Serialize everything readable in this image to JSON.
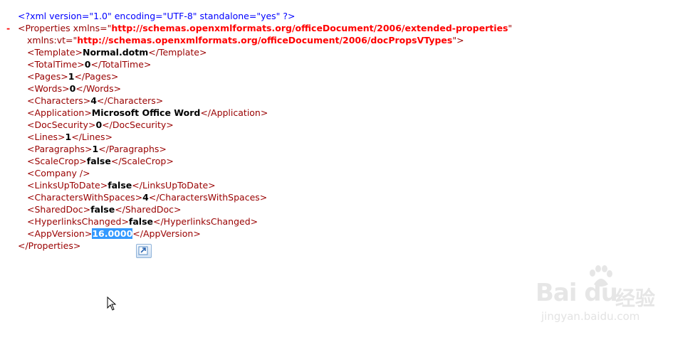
{
  "xml_declaration": "<?xml version=\"1.0\" encoding=\"UTF-8\" standalone=\"yes\" ?>",
  "collapse_marker": "-",
  "root": {
    "open_prefix": "<Properties ",
    "attr1_name": "xmlns=\"",
    "attr1_value": "http://schemas.openxmlformats.org/officeDocument/2006/extended-properties",
    "attr1_close": "\"",
    "attr2_name": "xmlns:vt=\"",
    "attr2_value": "http://schemas.openxmlformats.org/officeDocument/2006/docPropsVTypes",
    "attr2_close": "\">",
    "close_tag": "</Properties>"
  },
  "elements": [
    {
      "open": "<Template>",
      "value": "Normal.dotm",
      "close": "</Template>"
    },
    {
      "open": "<TotalTime>",
      "value": "0",
      "close": "</TotalTime>"
    },
    {
      "open": "<Pages>",
      "value": "1",
      "close": "</Pages>"
    },
    {
      "open": "<Words>",
      "value": "0",
      "close": "</Words>"
    },
    {
      "open": "<Characters>",
      "value": "4",
      "close": "</Characters>"
    },
    {
      "open": "<Application>",
      "value": "Microsoft Office Word",
      "close": "</Application>"
    },
    {
      "open": "<DocSecurity>",
      "value": "0",
      "close": "</DocSecurity>"
    },
    {
      "open": "<Lines>",
      "value": "1",
      "close": "</Lines>"
    },
    {
      "open": "<Paragraphs>",
      "value": "1",
      "close": "</Paragraphs>"
    },
    {
      "open": "<ScaleCrop>",
      "value": "false",
      "close": "</ScaleCrop>"
    },
    {
      "open": "<Company />",
      "value": "",
      "close": ""
    },
    {
      "open": "<LinksUpToDate>",
      "value": "false",
      "close": "</LinksUpToDate>"
    },
    {
      "open": "<CharactersWithSpaces>",
      "value": "4",
      "close": "</CharactersWithSpaces>"
    },
    {
      "open": "<SharedDoc>",
      "value": "false",
      "close": "</SharedDoc>"
    },
    {
      "open": "<HyperlinksChanged>",
      "value": "false",
      "close": "</HyperlinksChanged>"
    },
    {
      "open": "<AppVersion>",
      "value": "16.0000",
      "close": "</AppVersion>",
      "selected": true
    }
  ],
  "watermark": {
    "logo": "Bai du",
    "cn": "经验",
    "url": "jingyan.baidu.com"
  },
  "icons": {
    "paste_options": "paste-options-icon",
    "cursor": "mouse-pointer-icon",
    "paw": "baidu-paw-icon"
  }
}
